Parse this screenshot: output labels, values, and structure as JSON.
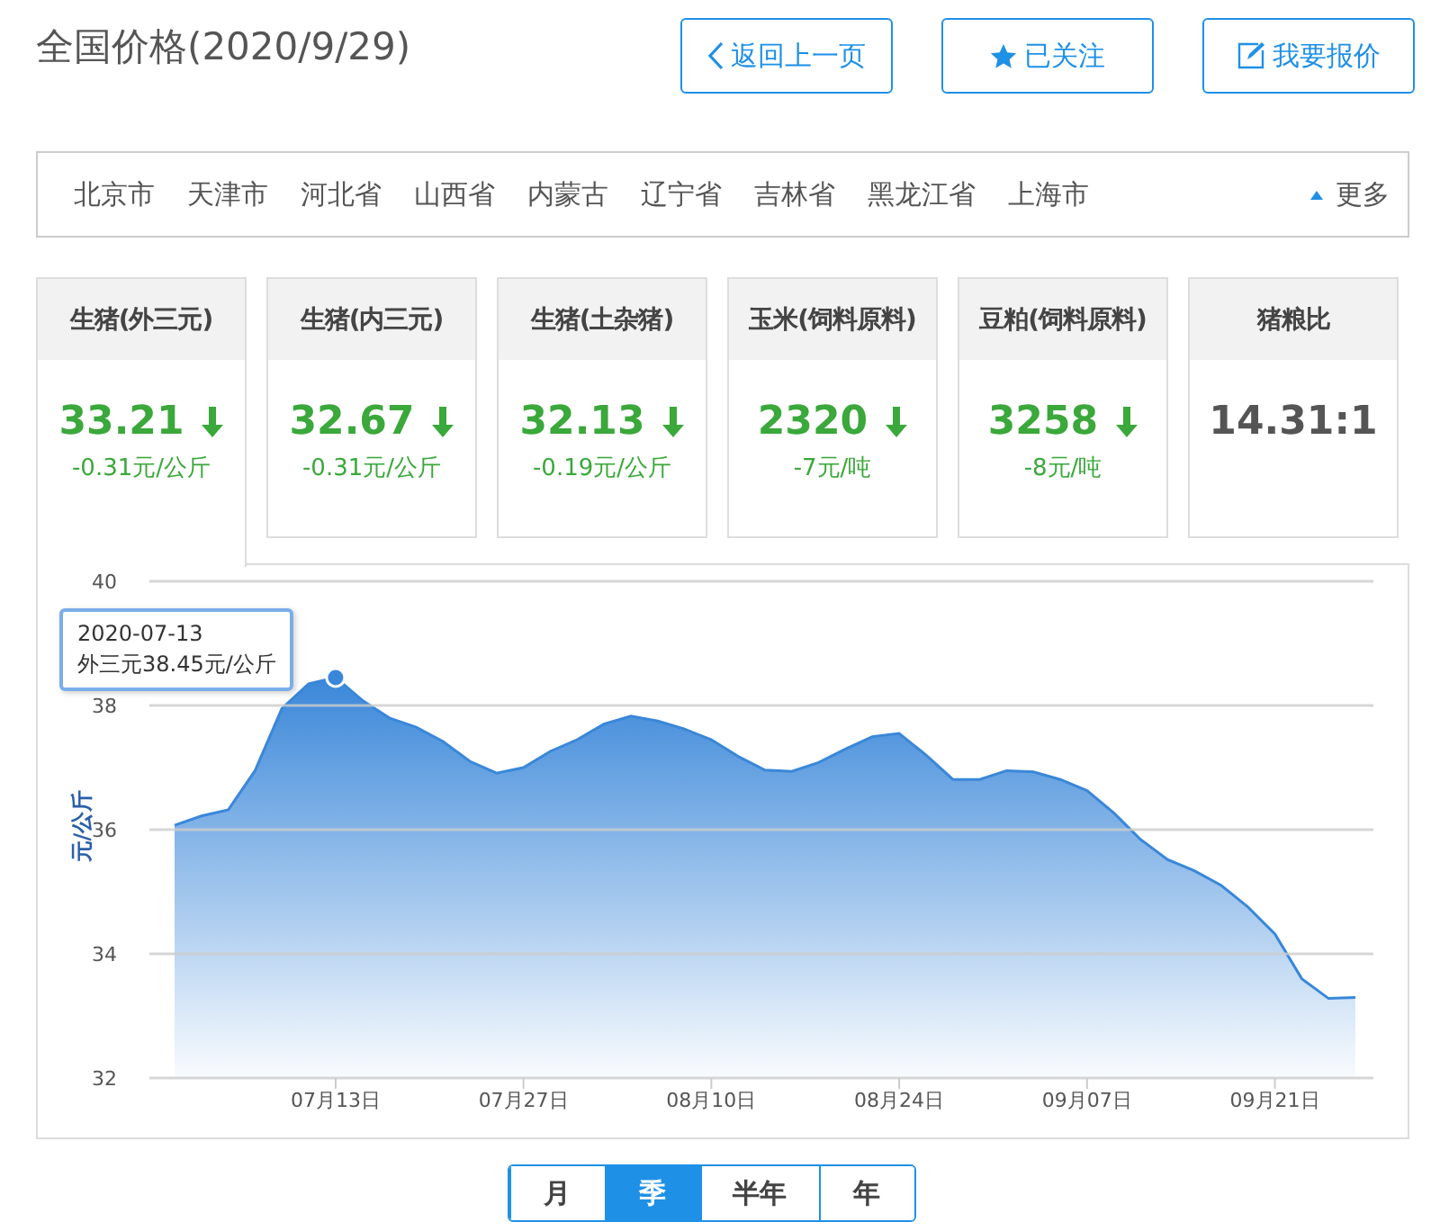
{
  "header": {
    "title": "全国价格(2020/9/29)",
    "buttons": [
      {
        "kind": "back",
        "label": "返回上一页"
      },
      {
        "kind": "follow",
        "label": "已关注"
      },
      {
        "kind": "quote",
        "label": "我要报价"
      }
    ]
  },
  "regions": {
    "items": [
      "北京市",
      "天津市",
      "河北省",
      "山西省",
      "内蒙古",
      "辽宁省",
      "吉林省",
      "黑龙江省",
      "上海市"
    ],
    "more": "更多"
  },
  "cards": [
    {
      "kind": "falling",
      "title": "生猪(外三元)",
      "value": "33.21",
      "change": "-0.31元/公斤",
      "selected": true
    },
    {
      "kind": "falling",
      "title": "生猪(内三元)",
      "value": "32.67",
      "change": "-0.31元/公斤",
      "selected": false
    },
    {
      "kind": "falling",
      "title": "生猪(土杂猪)",
      "value": "32.13",
      "change": "-0.19元/公斤",
      "selected": false
    },
    {
      "kind": "falling",
      "title": "玉米(饲料原料)",
      "value": "2320",
      "change": "-7元/吨",
      "selected": false
    },
    {
      "kind": "falling",
      "title": "豆粕(饲料原料)",
      "value": "3258",
      "change": "-8元/吨",
      "selected": false
    },
    {
      "kind": "plain",
      "title": "猪粮比",
      "value": "14.31:1",
      "selected": false
    }
  ],
  "chart": {
    "chart_data": {
      "type": "area",
      "grid": true,
      "ylabel": "元/公斤",
      "ylim": [
        32,
        40
      ],
      "yticks": [
        32,
        34,
        36,
        38,
        40
      ],
      "categories": [
        null,
        null,
        null,
        null,
        null,
        null,
        "07月13日",
        null,
        null,
        null,
        null,
        null,
        null,
        "07月27日",
        null,
        null,
        null,
        null,
        null,
        null,
        "08月10日",
        null,
        null,
        null,
        null,
        null,
        null,
        "08月24日",
        null,
        null,
        null,
        null,
        null,
        null,
        "09月07日",
        null,
        null,
        null,
        null,
        null,
        null,
        "09月21日",
        null,
        null,
        null
      ],
      "series": [
        {
          "color": "#3a87d9",
          "values": [
            36.07,
            36.22,
            36.32,
            36.95,
            37.95,
            38.35,
            38.45,
            38.08,
            37.8,
            37.65,
            37.42,
            37.1,
            36.91,
            37.0,
            37.26,
            37.45,
            37.7,
            37.83,
            37.75,
            37.62,
            37.45,
            37.18,
            36.96,
            36.94,
            37.08,
            37.3,
            37.5,
            37.55,
            37.2,
            36.81,
            36.81,
            36.95,
            36.93,
            36.81,
            36.63,
            36.27,
            35.84,
            35.52,
            35.34,
            35.1,
            34.75,
            34.32,
            33.6,
            33.28,
            33.3
          ]
        }
      ]
    },
    "tooltip": {
      "date": "2020-07-13",
      "text": "外三元38.45元/公斤"
    }
  },
  "ranges": [
    {
      "label": "月",
      "selected": false
    },
    {
      "label": "季",
      "selected": true
    },
    {
      "label": "半年",
      "selected": false
    },
    {
      "label": "年",
      "selected": false
    }
  ]
}
